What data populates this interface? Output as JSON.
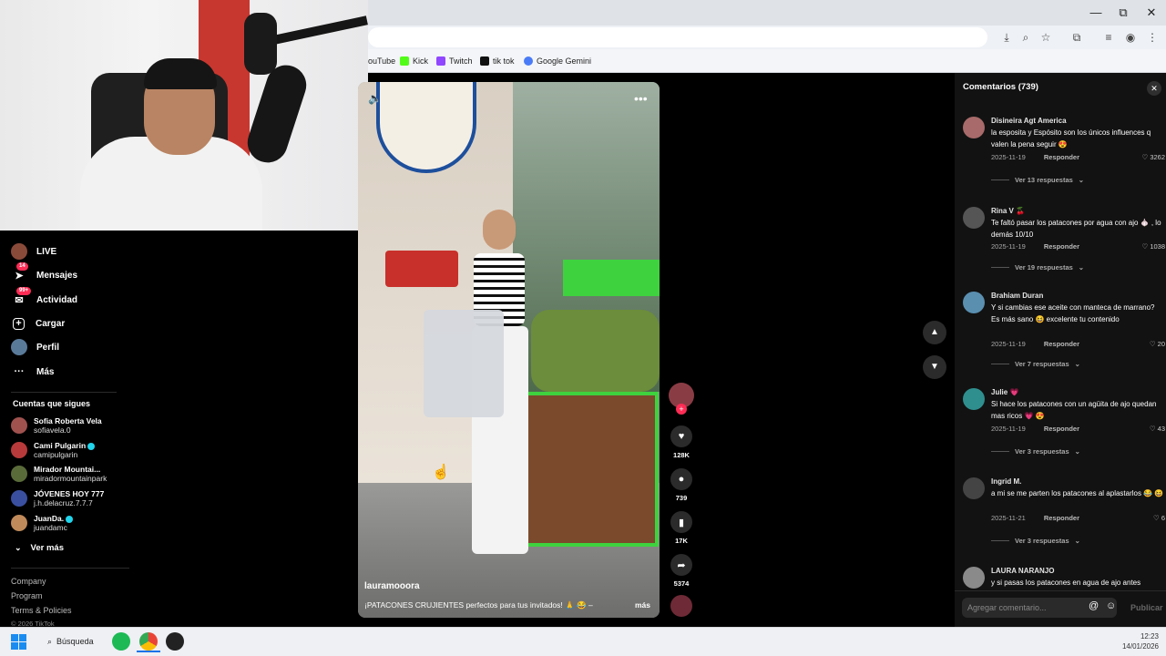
{
  "browser": {
    "window_buttons": [
      "—",
      "⧉",
      "✕"
    ],
    "bookmarks": [
      {
        "label": "ouTube",
        "color": "#ff0000"
      },
      {
        "label": "Kick",
        "color": "#53fc18"
      },
      {
        "label": "Twitch",
        "color": "#9146ff"
      },
      {
        "label": "tik tok",
        "color": "#111111"
      },
      {
        "label": "Google Gemini",
        "color": "#4a7bf7"
      }
    ]
  },
  "sidebar": {
    "nav": [
      {
        "label": "LIVE",
        "icon": "live-avatar-icon",
        "badge": ""
      },
      {
        "label": "Mensajes",
        "icon": "messages-icon",
        "badge": "14"
      },
      {
        "label": "Actividad",
        "icon": "activity-icon",
        "badge": "99+"
      },
      {
        "label": "Cargar",
        "icon": "upload-icon",
        "badge": ""
      },
      {
        "label": "Perfil",
        "icon": "profile-icon",
        "badge": ""
      },
      {
        "label": "Más",
        "icon": "more-icon",
        "badge": ""
      }
    ],
    "following_title": "Cuentas que sigues",
    "following": [
      {
        "name": "Sofia Roberta Vela",
        "handle": "sofiavela.0",
        "verified": false,
        "color": "#a0524f"
      },
      {
        "name": "Cami Pulgarin",
        "handle": "camipulgarin",
        "verified": true,
        "color": "#b83a3a"
      },
      {
        "name": "Mirador Mountai...",
        "handle": "miradormountainpark",
        "verified": false,
        "color": "#5a6b3a"
      },
      {
        "name": "JÓVENES HOY 777",
        "handle": "j.h.delacruz.7.7.7",
        "verified": false,
        "color": "#3a4fa0"
      },
      {
        "name": "JuanDa.",
        "handle": "juandamc",
        "verified": true,
        "color": "#c08a5a"
      }
    ],
    "see_more": "Ver más",
    "footer": [
      "Company",
      "Program",
      "Terms & Policies",
      "© 2026 TikTok"
    ]
  },
  "video": {
    "username": "lauramooora",
    "caption": "¡PATACONES CRUJIENTES perfectos para tus invitados! 🙏 😂 –",
    "more": "más",
    "menu": "•••",
    "volume": "🔈"
  },
  "actions": {
    "likes": "128K",
    "comments": "739",
    "saves": "17K",
    "shares": "5374"
  },
  "comments_panel": {
    "title": "Comentarios",
    "count": "(739)",
    "items": [
      {
        "user": "Disineira Agt America",
        "text": "la esposita y Espósito son los únicos influences q valen la pena seguir 😍",
        "date": "2025-11-19",
        "reply": "Responder",
        "likes": "3262",
        "replies": "Ver 13 respuestas",
        "color": "#a86a6a"
      },
      {
        "user": "Rina V 🍒",
        "text": "Te faltó pasar los patacones por agua con ajo 🧄 , lo demás 10/10",
        "date": "2025-11-19",
        "reply": "Responder",
        "likes": "1038",
        "replies": "Ver 19 respuestas",
        "color": "#555555"
      },
      {
        "user": "Brahiam Duran",
        "text": "Y si cambias ese aceite con manteca de marrano? Es más sano 😆 excelente tu contenido",
        "date": "2025-11-19",
        "reply": "Responder",
        "likes": "20",
        "replies": "Ver 7 respuestas",
        "color": "#5a8fb0"
      },
      {
        "user": "Julie 💗",
        "text": "Si hace los patacones con un agüita de ajo quedan mas ricos 💗 😍",
        "date": "2025-11-19",
        "reply": "Responder",
        "likes": "43",
        "replies": "Ver 3 respuestas",
        "color": "#2f8f8f"
      },
      {
        "user": "Ingrid M.",
        "text": "a mi se me parten los patacones al aplastarlos 😂 😆",
        "date": "2025-11-21",
        "reply": "Responder",
        "likes": "6",
        "replies": "Ver 3 respuestas",
        "color": "#444444"
      },
      {
        "user": "LAURA NARANJO",
        "text": "y si pasas los patacones en agua de ajo antes",
        "date": "",
        "reply": "",
        "likes": "",
        "replies": "",
        "color": "#8a8a8a"
      }
    ],
    "input_placeholder": "Agregar comentario...",
    "post": "Publicar"
  },
  "taskbar": {
    "search": "Búsqueda",
    "time": "12:23",
    "date": "14/01/2026"
  },
  "colors": {
    "accent": "#fe2c55",
    "verified": "#20d5ec"
  }
}
